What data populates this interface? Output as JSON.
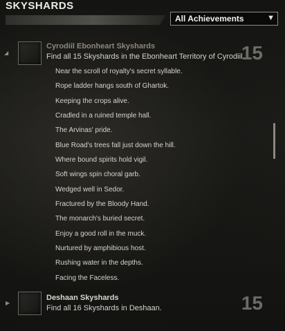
{
  "window": {
    "title": "SKYSHARDS"
  },
  "filter": {
    "selected": "All Achievements",
    "arrow_icon": "triangle-down-icon"
  },
  "achievements": [
    {
      "title": "Cyrodiil Ebonheart Skyshards",
      "description": "Find all 15 Skyshards in the Ebonheart Territory of Cyrodiil.",
      "points": "15",
      "expanded": true,
      "title_color": "#8c877c",
      "criteria": [
        "Near the scroll of royalty's secret syllable.",
        "Rope ladder hangs south of Ghartok.",
        "Keeping the crops alive.",
        "Cradled in a ruined temple hall.",
        "The Arvinas' pride.",
        "Blue Road's trees fall just down the hill.",
        "Where bound spirits hold vigil.",
        "Soft wings spin choral garb.",
        "Wedged well in Sedor.",
        "Fractured by the Bloody Hand.",
        "The monarch's buried secret.",
        "Enjoy a good roll in the muck.",
        "Nurtured by amphibious host.",
        "Rushing water in the depths.",
        "Facing the Faceless."
      ]
    },
    {
      "title": "Deshaan Skyshards",
      "description": "Find all 16 Skyshards in Deshaan.",
      "points": "15",
      "expanded": false,
      "title_color": "#d8d5cc"
    }
  ]
}
